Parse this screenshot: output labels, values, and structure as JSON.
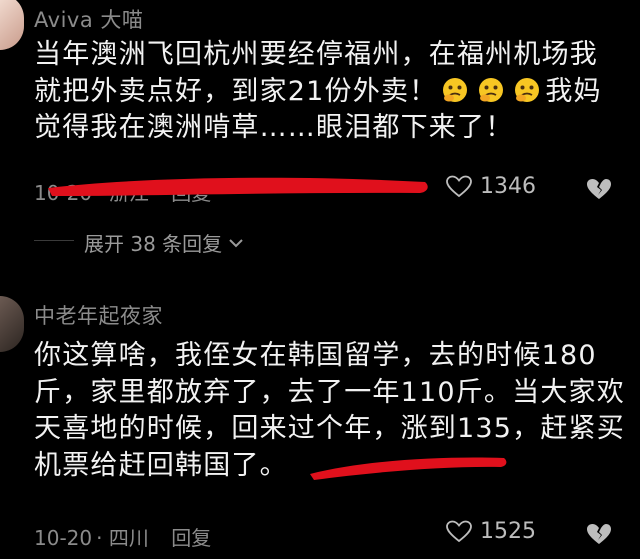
{
  "comments": [
    {
      "username": "Aviva 大喵",
      "text_a": "当年澳洲飞回杭州要经停福州，在福州机场我就把外卖点好，到家21份外卖！",
      "text_b": "我妈觉得我在澳洲啃草……眼泪都下来了！",
      "emojis": [
        "thinking-face-emoji",
        "thinking-face-emoji",
        "thinking-face-emoji"
      ],
      "date": "10-20",
      "location": "浙江",
      "reply_label": "回复",
      "likes": "1346"
    },
    {
      "username": "中老年起夜家",
      "text_a": "你这算啥，我侄女在韩国留学，去的时候180斤，家里都放弃了，去了一年110斤。当大家欢天喜地的时候，回来过个年，",
      "highlight": "涨到135，",
      "text_b": "赶紧买机票给赶回韩国了。",
      "date": "10-20",
      "location": "四川",
      "reply_label": "回复",
      "likes": "1525"
    }
  ],
  "expand_label": "展开 38 条回复",
  "icons": {
    "like": "heart-outline-icon",
    "dislike": "broken-heart-icon",
    "expand": "chevron-down-icon"
  },
  "colors": {
    "background": "#000000",
    "annotation": "#e0101c",
    "meta_text": "#8b8b8b"
  }
}
